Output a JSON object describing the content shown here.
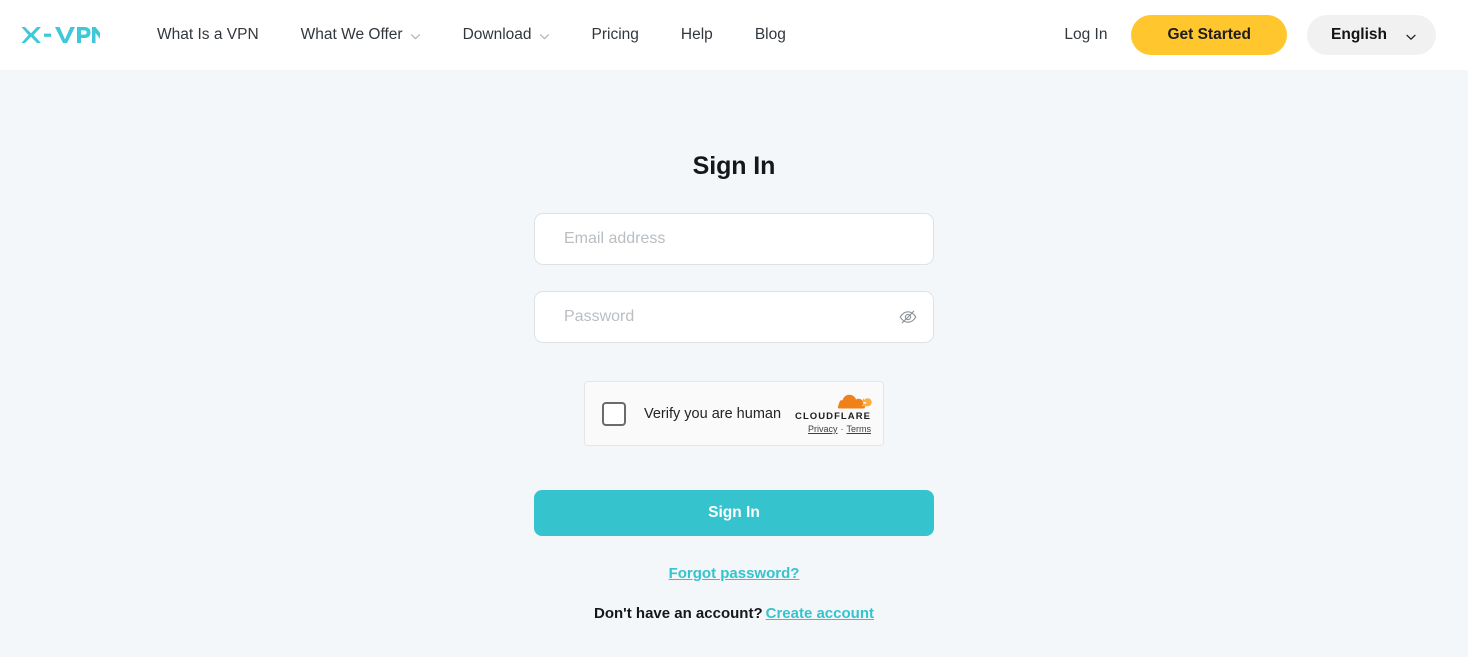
{
  "brand": {
    "logo_text": "X-VPN",
    "logo_accent_color": "#3ec8d8"
  },
  "header": {
    "nav_items": [
      {
        "label": "What Is a VPN",
        "has_dropdown": false,
        "name": "nav-what-is-a-vpn"
      },
      {
        "label": "What We Offer",
        "has_dropdown": true,
        "name": "nav-what-we-offer"
      },
      {
        "label": "Download",
        "has_dropdown": true,
        "name": "nav-download"
      },
      {
        "label": "Pricing",
        "has_dropdown": false,
        "name": "nav-pricing"
      },
      {
        "label": "Help",
        "has_dropdown": false,
        "name": "nav-help"
      },
      {
        "label": "Blog",
        "has_dropdown": false,
        "name": "nav-blog"
      }
    ],
    "login_label": "Log In",
    "get_started_label": "Get Started",
    "get_started_color": "#ffc62e",
    "language_label": "English",
    "language_chevron_icon": "chevron-down-icon"
  },
  "main": {
    "title": "Sign In",
    "email": {
      "placeholder": "Email address",
      "value": ""
    },
    "password": {
      "placeholder": "Password",
      "value": "",
      "toggle_icon": "eye-off-icon"
    },
    "turnstile": {
      "label": "Verify you are human",
      "checked": false,
      "brand_name": "CLOUDFLARE",
      "brand_logo_icon": "cloudflare-cloud-icon",
      "privacy_label": "Privacy",
      "separator": "·",
      "terms_label": "Terms"
    },
    "submit_label": "Sign In",
    "submit_color": "#35c3ce",
    "forgot_password_label": "Forgot password?",
    "signup_prompt": "Don't have an account?",
    "create_account_label": "Create account",
    "link_color": "#35c3ce"
  }
}
